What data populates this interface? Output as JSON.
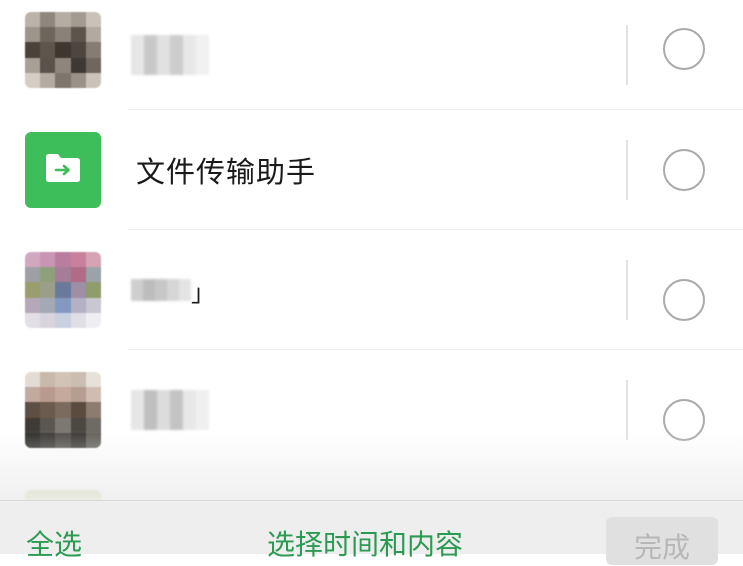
{
  "contacts": [
    {
      "name": "",
      "obscured": true,
      "avatar_colors": [
        "#b9b3aa",
        "#8e877d",
        "#b5ada3",
        "#a39b90",
        "#c8c2b8",
        "#9d958a",
        "#6e665c",
        "#8a8278",
        "#5d554c",
        "#b1aaa0",
        "#4a433b",
        "#5e564d",
        "#3d3730",
        "#4d463f",
        "#857d73",
        "#a8a095",
        "#5a534b",
        "#8e867c",
        "#3e3832",
        "#6f675e",
        "#d3cdc4",
        "#b3aca2",
        "#7d766d",
        "#9a9288",
        "#c9c3ba"
      ],
      "name_mosaic": [
        "#e6e6e6",
        "#c9c9c9",
        "#e1e1e1",
        "#cdcdcd",
        "#e8e8e8",
        "#f1f1f1"
      ],
      "selected": false
    },
    {
      "name": "文件传输助手",
      "obscured": false,
      "avatar_icon": "folder-transfer-icon",
      "avatar_color": "#3ebd5b",
      "selected": false
    },
    {
      "name": "",
      "obscured": true,
      "name_suffix": "」",
      "avatar_colors": [
        "#d2a8c0",
        "#c896b4",
        "#b97d9e",
        "#c9809c",
        "#d6a3b5",
        "#9f9fa6",
        "#8ea07a",
        "#a67d97",
        "#b06b86",
        "#9aa4a8",
        "#9a9e6f",
        "#9b9f8a",
        "#6a7a9b",
        "#9e8ea6",
        "#8f9c6c",
        "#b6a8b8",
        "#a4a9b6",
        "#8499c2",
        "#b4b0c6",
        "#c9c7d1",
        "#e3dfe7",
        "#d7d4de",
        "#c9d0e0",
        "#e1dfe6",
        "#efeef2"
      ],
      "name_mosaic": [
        "#cfcfcf",
        "#bdbdbd",
        "#c7c7c7",
        "#d6d6d6",
        "#e4e4e4"
      ],
      "selected": false
    },
    {
      "name": "",
      "obscured": true,
      "avatar_colors": [
        "#e2dcd5",
        "#c9b9ab",
        "#d1c3b6",
        "#cbbdb1",
        "#e7e1da",
        "#c3aa9f",
        "#b89b8e",
        "#c4a99c",
        "#b59d92",
        "#d0bcb1",
        "#5e4f44",
        "#6b5a4e",
        "#7b6b5f",
        "#5a4a3f",
        "#8c7b6f",
        "#3e3a36",
        "#5a5650",
        "#7d7872",
        "#4b4741",
        "#6e6a64",
        "#2e2c29",
        "#3b3936",
        "#504d49",
        "#3a3835",
        "#625f5a"
      ],
      "name_mosaic": [
        "#e6e6e6",
        "#bfbfbf",
        "#dcdcdc",
        "#c3c3c3",
        "#e8e8e8",
        "#f0f0f0"
      ],
      "selected": false
    }
  ],
  "footer": {
    "select_all_label": "全选",
    "select_time_label": "选择时间和内容",
    "done_label": "完成"
  },
  "colors": {
    "accent_green": "#2b9a52",
    "disabled_text": "#b7b7b7",
    "disabled_button": "#e0e0e0",
    "footer_bg": "#eeeeee"
  }
}
